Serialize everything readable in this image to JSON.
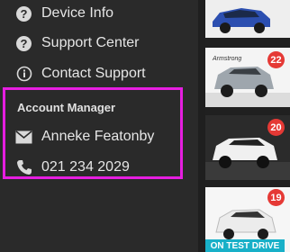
{
  "menu": {
    "items": [
      {
        "label": "Device Info",
        "icon": "question-circle-icon"
      },
      {
        "label": "Support Center",
        "icon": "question-circle-icon"
      },
      {
        "label": "Contact Support",
        "icon": "info-circle-icon"
      }
    ],
    "account_manager": {
      "title": "Account Manager",
      "name": "Anneke Featonby",
      "phone": "021 234 2029"
    }
  },
  "cards": [
    {
      "icon": "car-blue-icon"
    },
    {
      "badge": "22",
      "brand": "Armstrong",
      "icon": "car-grey-suv-icon"
    },
    {
      "badge": "20",
      "icon": "car-white-suv-icon"
    },
    {
      "badge": "19",
      "tag": "ON TEST DRIVE",
      "icon": "car-white-suv-icon"
    }
  ],
  "colors": {
    "highlight": "#e61ee0",
    "badge": "#e53935",
    "tag": "#18b0c8"
  }
}
